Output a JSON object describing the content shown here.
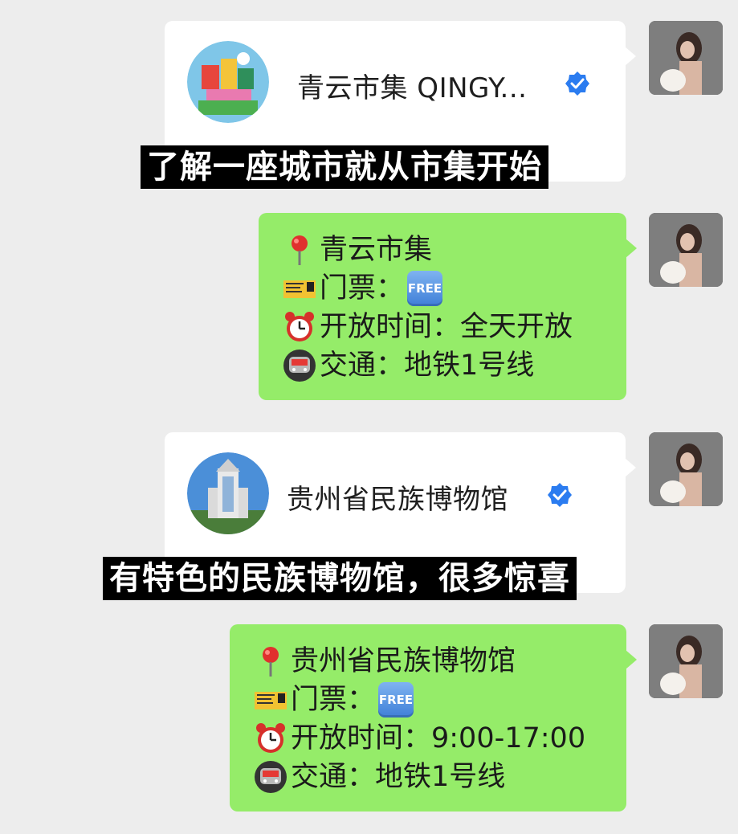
{
  "messages": [
    {
      "type": "card",
      "account_name": "青云市集 QINGY...",
      "caption": "了解一座城市就从市集开始"
    },
    {
      "type": "info",
      "title": "青云市集",
      "ticket_label": "门票：",
      "ticket_badge": "FREE",
      "hours": "开放时间：全天开放",
      "transport": "交通：地铁1号线"
    },
    {
      "type": "card",
      "account_name": "贵州省民族博物馆",
      "caption": "有特色的民族博物馆，很多惊喜"
    },
    {
      "type": "info",
      "title": "贵州省民族博物馆",
      "ticket_label": "门票：",
      "ticket_badge": "FREE",
      "hours": "开放时间：9:00-17:00",
      "transport": "交通：地铁1号线"
    }
  ],
  "colors": {
    "background": "#ededed",
    "sent_bubble": "#95ec69",
    "card": "#ffffff",
    "verified_badge": "#2b7cf0"
  },
  "icons": [
    "pin-icon",
    "ticket-icon",
    "alarm-clock-icon",
    "metro-train-icon",
    "verified-badge-icon"
  ]
}
